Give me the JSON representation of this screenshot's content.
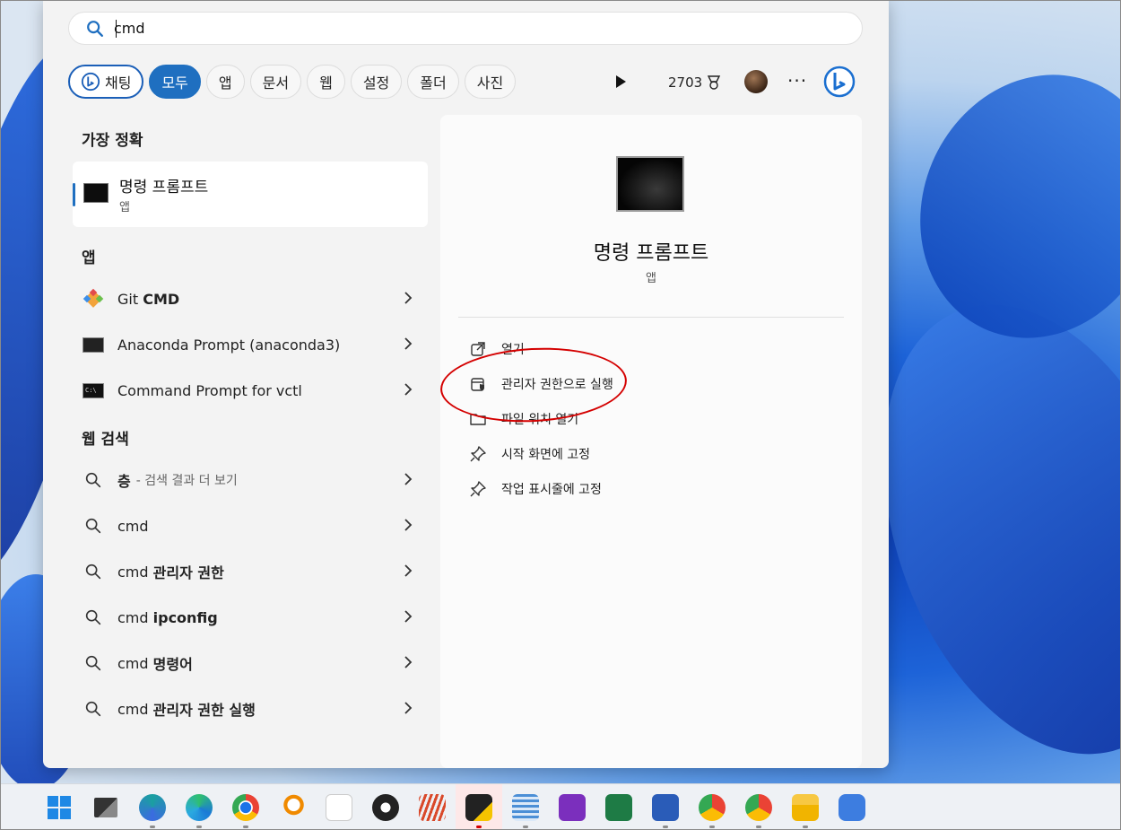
{
  "search": {
    "value": "cmd"
  },
  "filters": {
    "chat_label": "채팅",
    "items": [
      "모두",
      "앱",
      "문서",
      "웹",
      "설정",
      "폴더",
      "사진"
    ],
    "points": "2703"
  },
  "sections": {
    "best_match": "가장 정확",
    "apps": "앱",
    "web": "웹 검색"
  },
  "best_match": {
    "title": "명령 프롬프트",
    "subtitle": "앱"
  },
  "apps": [
    {
      "pre": "Git ",
      "bold": "CMD"
    },
    {
      "pre": "Anaconda Prompt (anaconda3)",
      "bold": ""
    },
    {
      "pre": "Command Prompt for vctl",
      "bold": ""
    }
  ],
  "web": [
    {
      "pre": "",
      "bold": "층",
      "sub": "- 검색 결과 더 보기"
    },
    {
      "pre": "cmd",
      "bold": "",
      "sub": ""
    },
    {
      "pre": "cmd ",
      "bold": "관리자 권한",
      "sub": ""
    },
    {
      "pre": "cmd ",
      "bold": "ipconfig",
      "sub": ""
    },
    {
      "pre": "cmd ",
      "bold": "명령어",
      "sub": ""
    },
    {
      "pre": "cmd ",
      "bold": "관리자 권한 실행",
      "sub": ""
    }
  ],
  "preview": {
    "title": "명령 프롬프트",
    "subtitle": "앱",
    "actions": [
      "열기",
      "관리자 권한으로 실행",
      "파일 위치 열기",
      "시작 화면에 고정",
      "작업 표시줄에 고정"
    ]
  },
  "taskbar_icons": [
    "start-icon",
    "task-view-icon",
    "app-icon",
    "edge-icon",
    "chrome-icon",
    "search-app-icon",
    "app-icon",
    "obs-icon",
    "app-icon",
    "sticky-notes-icon",
    "notepad-icon",
    "onenote-icon",
    "excel-icon",
    "word-icon",
    "chrome-icon",
    "chrome-icon",
    "file-explorer-icon",
    "app-icon"
  ],
  "colors": {
    "accent": "#1f6fc0",
    "highlight_circle": "#d40000"
  }
}
